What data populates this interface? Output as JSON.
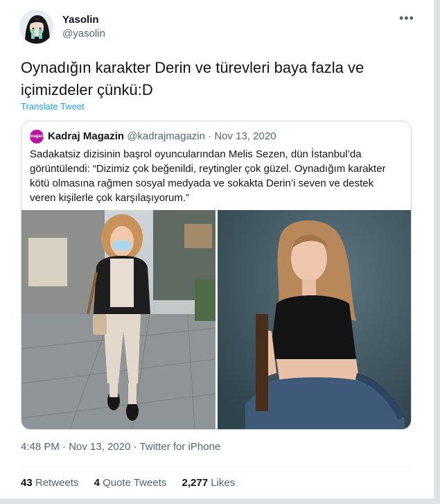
{
  "author": {
    "display_name": "Yasolin",
    "handle": "@yasolin"
  },
  "tweet": {
    "text_line1": "Oynadığın karakter Derin ve türevleri baya fazla ve",
    "text_line2": "içimizdeler çünkü:D",
    "translate_label": "Translate Tweet"
  },
  "quoted": {
    "avatar_text": "magazin",
    "name": "Kadraj Magazin",
    "handle": "@kadrajmagazin",
    "separator": "·",
    "date": "Nov 13, 2020",
    "text": "Sadakatsiz dizisinin başrol oyuncularından Melis Sezen, dün İstanbul’da görüntülendi: “Dizimiz çok beğenildi, reytingler çok güzel. Oynadığım karakter kötü olmasına rağmen sosyal medyada ve sokakta Derin’i seven ve destek veren kişilerle çok karşılaşıyorum.”"
  },
  "meta": {
    "time": "4:48 PM",
    "separator": "·",
    "date": "Nov 13, 2020",
    "source": "Twitter for iPhone"
  },
  "stats": {
    "retweets_count": "43",
    "retweets_label": "Retweets",
    "quotes_count": "4",
    "quotes_label": "Quote Tweets",
    "likes_count": "2,277",
    "likes_label": "Likes"
  },
  "icons": {
    "more": "more-horizontal-icon"
  },
  "colors": {
    "link": "#1d9bf0",
    "secondary_text": "#536471",
    "quoted_avatar": "#b5179e"
  }
}
